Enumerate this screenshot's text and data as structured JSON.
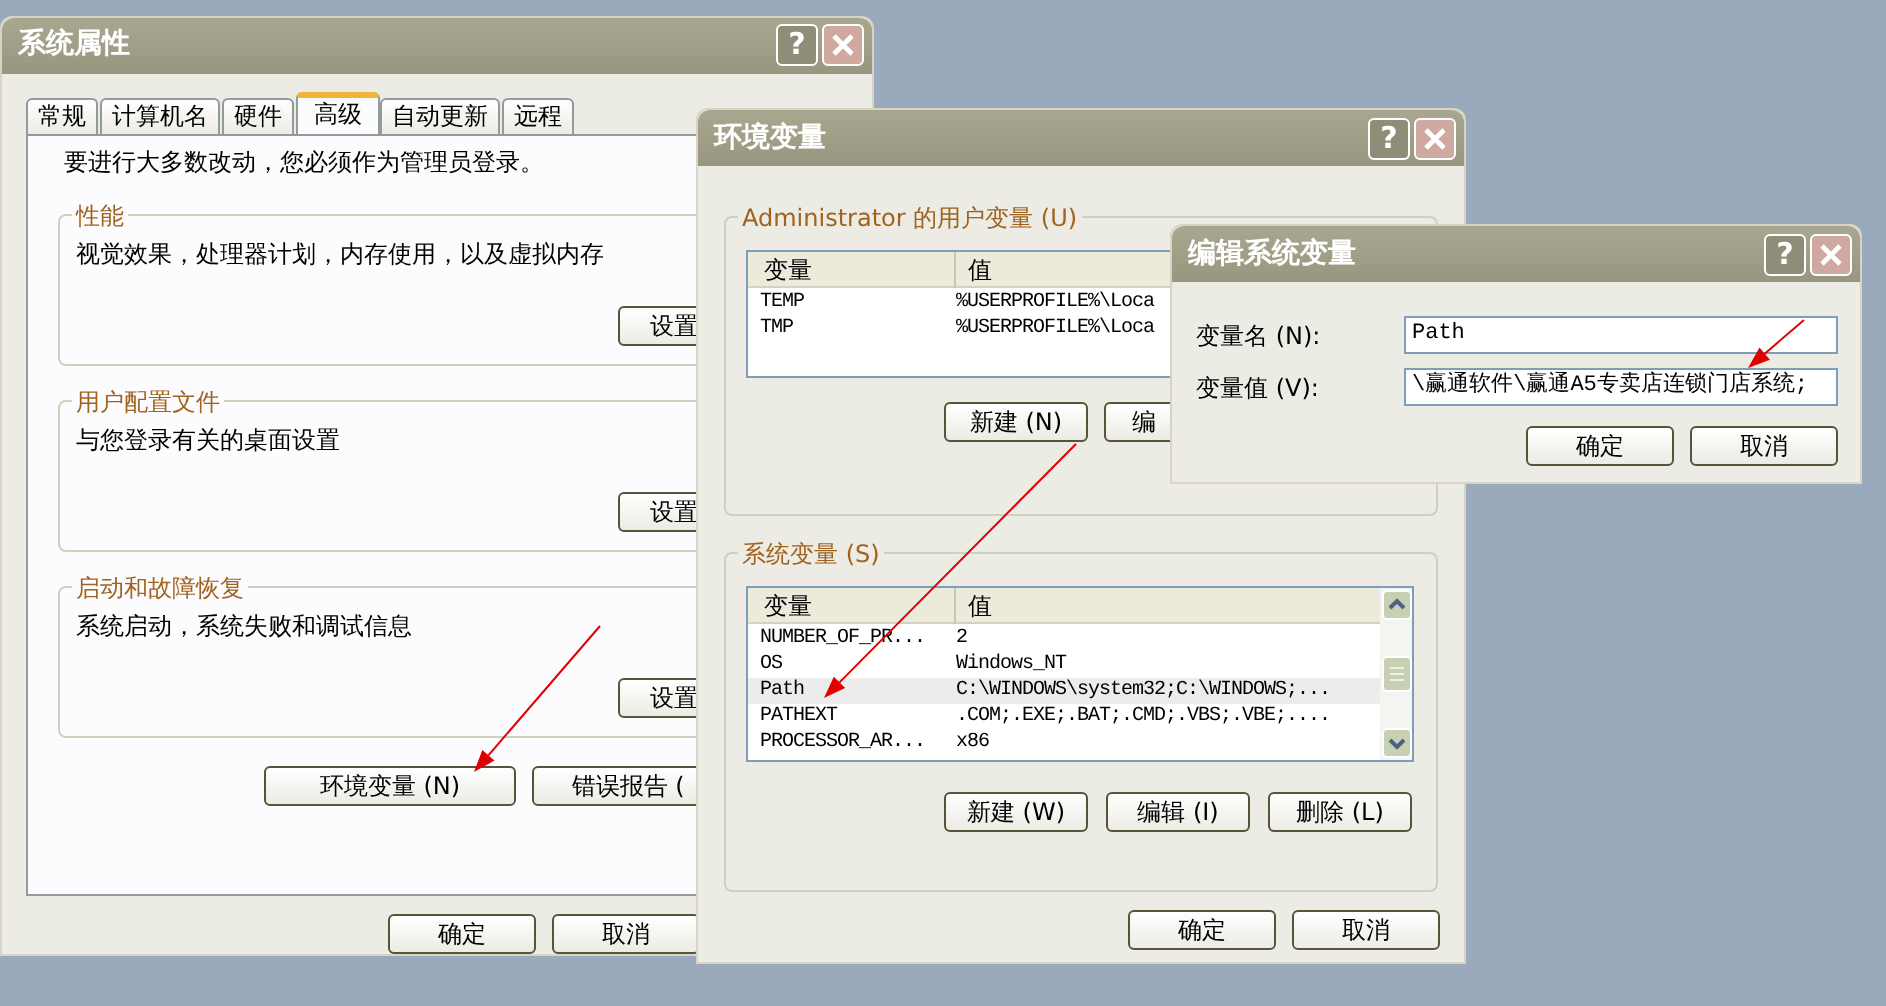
{
  "system_properties": {
    "title": "系统属性",
    "help_button": "?",
    "tabs": [
      {
        "label": "常规",
        "selected": false
      },
      {
        "label": "计算机名",
        "selected": false
      },
      {
        "label": "硬件",
        "selected": false
      },
      {
        "label": "高级",
        "selected": true
      },
      {
        "label": "自动更新",
        "selected": false
      },
      {
        "label": "远程",
        "selected": false
      }
    ],
    "notice": "要进行大多数改动，您必须作为管理员登录。",
    "groups": [
      {
        "title": "性能",
        "description": "视觉效果，处理器计划，内存使用，以及虚拟内存",
        "button": "设置"
      },
      {
        "title": "用户配置文件",
        "description": "与您登录有关的桌面设置",
        "button": "设置"
      },
      {
        "title": "启动和故障恢复",
        "description": "系统启动，系统失败和调试信息",
        "button": "设置"
      }
    ],
    "buttons": [
      "环境变量 (N)",
      "错误报告 ("
    ],
    "footer_buttons": [
      "确定",
      "取消"
    ]
  },
  "environment_variables": {
    "title": "环境变量",
    "help_button": "?",
    "user_group": {
      "title": "Administrator 的用户变量 (U)",
      "columns": [
        "变量",
        "值"
      ],
      "rows": [
        {
          "name": "TEMP",
          "value": "%USERPROFILE%\\Loca"
        },
        {
          "name": "TMP",
          "value": "%USERPROFILE%\\Loca"
        }
      ],
      "buttons": [
        "新建 (N)",
        "编"
      ]
    },
    "system_group": {
      "title": "系统变量 (S)",
      "columns": [
        "变量",
        "值"
      ],
      "rows": [
        {
          "name": "NUMBER_OF_PR...",
          "value": "2",
          "selected": false
        },
        {
          "name": "OS",
          "value": "Windows_NT",
          "selected": false
        },
        {
          "name": "Path",
          "value": "C:\\WINDOWS\\system32;C:\\WINDOWS;...",
          "selected": true
        },
        {
          "name": "PATHEXT",
          "value": ".COM;.EXE;.BAT;.CMD;.VBS;.VBE;....",
          "selected": false
        },
        {
          "name": "PROCESSOR_AR...",
          "value": "x86",
          "selected": false
        }
      ],
      "buttons": [
        "新建 (W)",
        "编辑 (I)",
        "删除 (L)"
      ]
    },
    "footer_buttons": [
      "确定",
      "取消"
    ]
  },
  "edit_system_variable": {
    "title": "编辑系统变量",
    "help_button": "?",
    "fields": [
      {
        "label": "变量名 (N):",
        "value": "Path"
      },
      {
        "label": "变量值 (V):",
        "value": "\\赢通软件\\赢通A5专卖店连锁门店系统;"
      }
    ],
    "buttons": [
      "确定",
      "取消"
    ]
  }
}
